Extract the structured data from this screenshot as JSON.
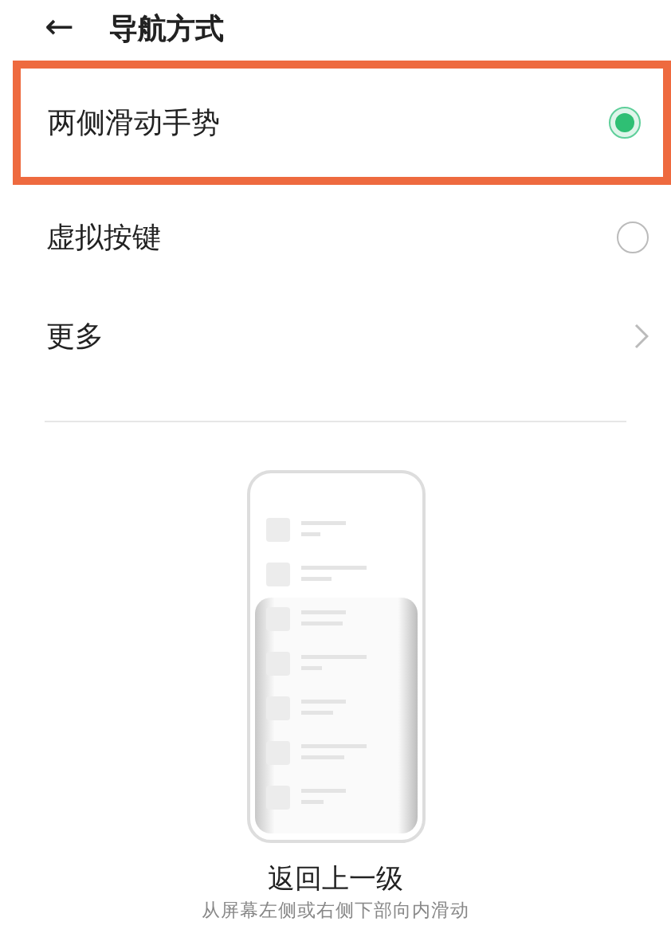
{
  "header": {
    "back_icon": "←",
    "title": "导航方式"
  },
  "options": [
    {
      "kind": "radio",
      "label": "两侧滑动手势",
      "selected": true,
      "highlighted": true
    },
    {
      "kind": "radio",
      "label": "虚拟按键",
      "selected": false,
      "highlighted": false
    },
    {
      "kind": "link",
      "label": "更多",
      "highlighted": false
    }
  ],
  "preview": {
    "caption": "返回上一级",
    "hint": "从屏幕左侧或右侧下部向内滑动"
  }
}
